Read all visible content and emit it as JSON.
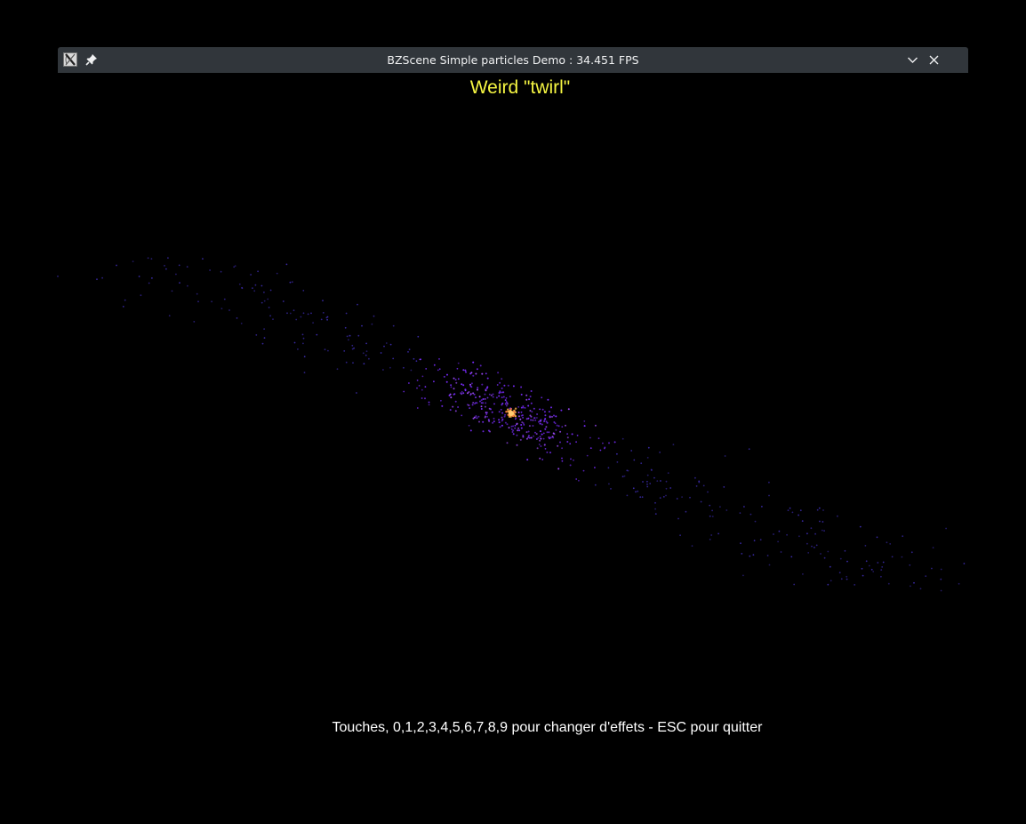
{
  "window": {
    "title": "BZScene Simple particles Demo : 34.451 FPS",
    "app_icon": "x-app-icon",
    "pin_icon": "pin-icon",
    "minimize_icon": "chevron-down-icon",
    "close_icon": "close-icon"
  },
  "scene": {
    "effect_title": "Weird \"twirl\"",
    "help_text": "Touches, 0,1,2,3,4,5,6,7,8,9 pour changer d'effets - ESC pour quitter",
    "colors": {
      "background": "#000000",
      "titlebar": "#31363b",
      "title_text": "#eff0f1",
      "effect_title": "#f5f542",
      "help_text": "#ffffff",
      "particle_core": "#ffb347",
      "particle_mid": "#7a2cff",
      "particle_outer": "#3a2aa8"
    }
  }
}
